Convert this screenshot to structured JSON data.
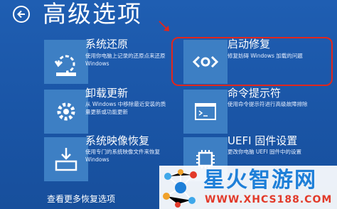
{
  "page": {
    "title": "高级选项",
    "more_link": "查看更多恢复选项"
  },
  "options": [
    {
      "title": "系统还原",
      "desc": "使用你电脑上记录的还原点来还原 Windows",
      "icon": "restore-icon"
    },
    {
      "title": "启动修复",
      "desc": "修复妨碍 Windows 加载的问题",
      "icon": "code-brackets-icon"
    },
    {
      "title": "卸载更新",
      "desc": "从 Windows 中移除最近安装的质量更新或功能更新",
      "icon": "gear-icon"
    },
    {
      "title": "命令提示符",
      "desc": "使用命令提示符进行高级故障排除",
      "icon": "command-prompt-icon"
    },
    {
      "title": "系统映像恢复",
      "desc": "使用专门的系统映像文件来恢复 Windows",
      "icon": "system-image-icon"
    },
    {
      "title": "UEFI 固件设置",
      "desc": "更改你电脑 UEFI 固件中的设置",
      "icon": "uefi-chip-icon"
    }
  ],
  "watermark": {
    "name": "星火智游网",
    "url": "WWW.XHCS188.COM"
  },
  "colors": {
    "background": "#1d57a8",
    "tile": "#3d7fc4",
    "highlight": "#e2261c",
    "watermark_name": "#1e7fd8",
    "watermark_url": "#e23a2a"
  }
}
